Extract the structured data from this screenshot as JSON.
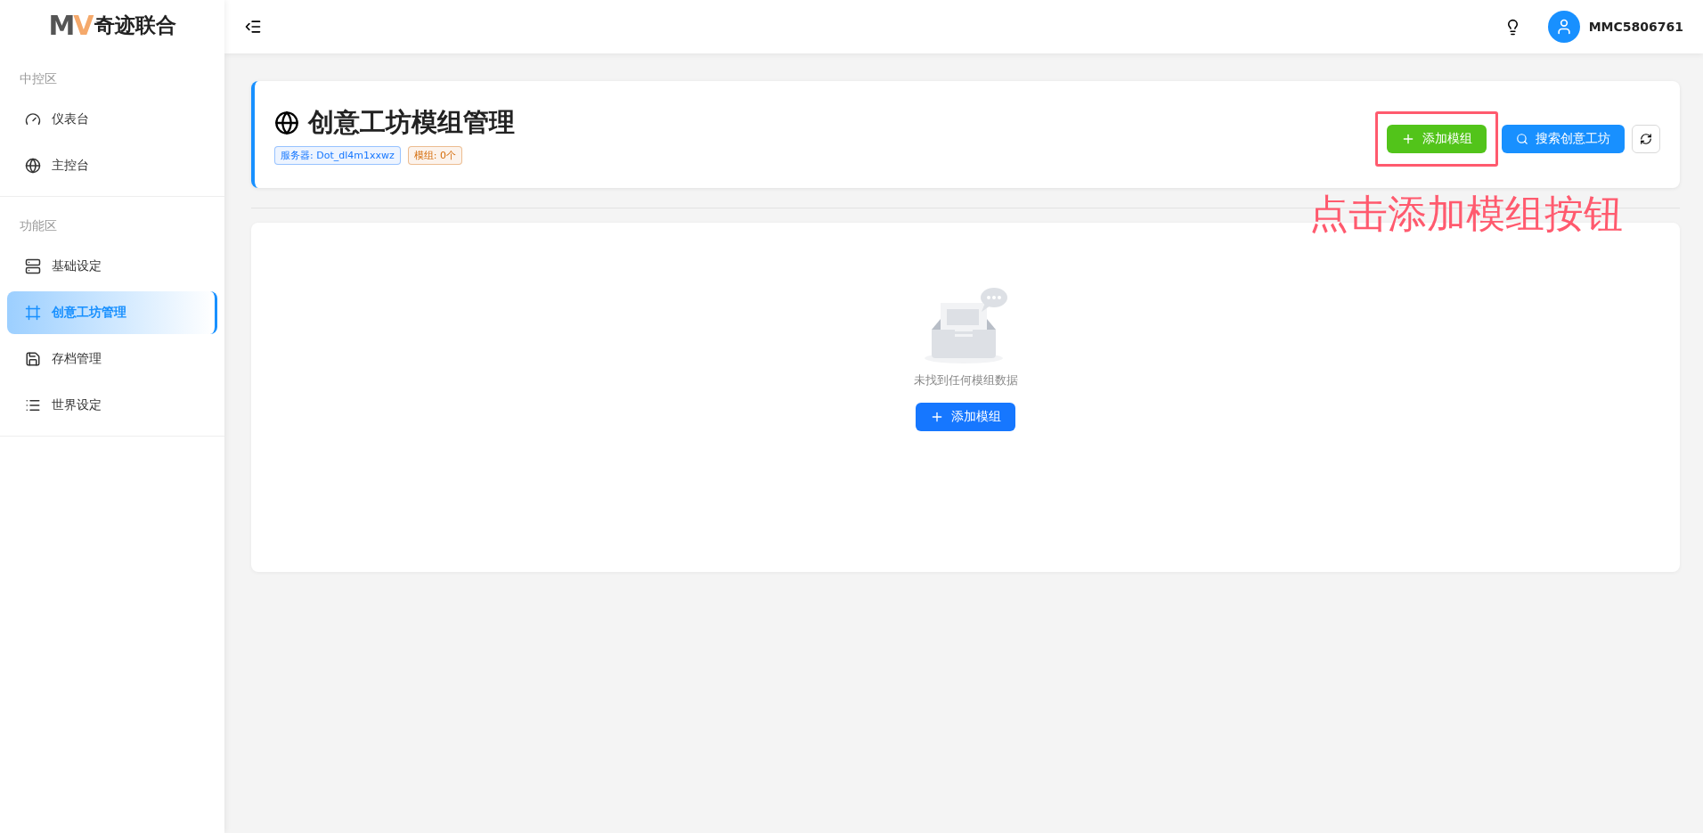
{
  "logo": {
    "mark": "MV",
    "name": "奇迹联合"
  },
  "sidebar": {
    "sections": [
      {
        "title": "中控区",
        "items": [
          {
            "label": "仪表台",
            "kind": "gauge",
            "selected": false
          },
          {
            "label": "主控台",
            "kind": "globe",
            "selected": false
          }
        ]
      },
      {
        "title": "功能区",
        "items": [
          {
            "label": "基础设定",
            "kind": "server",
            "selected": false
          },
          {
            "label": "创意工坊管理",
            "kind": "frame",
            "selected": true
          },
          {
            "label": "存档管理",
            "kind": "save",
            "selected": false
          },
          {
            "label": "世界设定",
            "kind": "list",
            "selected": false
          }
        ]
      }
    ]
  },
  "header": {
    "user": "MMC5806761"
  },
  "page": {
    "title": "创意工坊模组管理",
    "tags": [
      {
        "text": "服务器: Dot_dl4m1xxwz",
        "color": "#1677ff"
      },
      {
        "text": "模组: 0个",
        "color": "#d46b08"
      }
    ],
    "actions": [
      {
        "kind": "add",
        "label": "添加模组",
        "highlighted": true
      },
      {
        "kind": "search",
        "label": "搜索创意工坊",
        "highlighted": false
      },
      {
        "kind": "refresh",
        "highlighted": false
      }
    ]
  },
  "empty": {
    "message": "未找到任何模组数据",
    "button": "添加模组"
  },
  "annotation": {
    "text": "点击添加模组按钮"
  }
}
